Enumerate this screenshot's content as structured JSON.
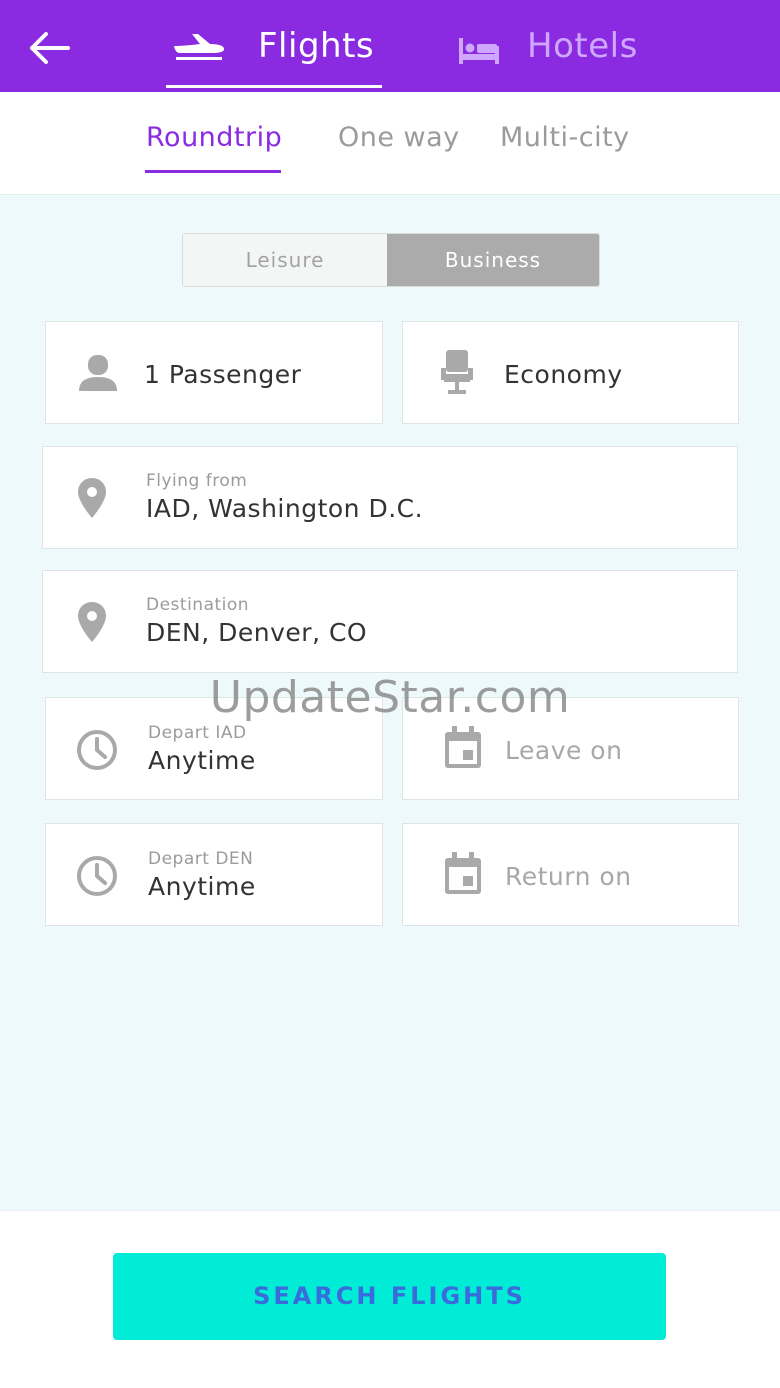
{
  "header": {
    "tabs": [
      {
        "label": "Flights",
        "icon": "plane-icon",
        "active": true
      },
      {
        "label": "Hotels",
        "icon": "bed-icon",
        "active": false
      }
    ],
    "back_icon": "back-arrow-icon",
    "color": "#8a2be2"
  },
  "trip_types": [
    {
      "label": "Roundtrip",
      "active": true
    },
    {
      "label": "One way",
      "active": false
    },
    {
      "label": "Multi-city",
      "active": false
    }
  ],
  "purpose": {
    "options": [
      "Leisure",
      "Business"
    ],
    "selected": "Business"
  },
  "passengers": {
    "value": "1 Passenger",
    "icon": "person-icon"
  },
  "cabin": {
    "value": "Economy",
    "icon": "seat-icon"
  },
  "origin": {
    "label": "Flying from",
    "value": "IAD, Washington D.C.",
    "icon": "location-pin-icon"
  },
  "destination": {
    "label": "Destination",
    "value": "DEN, Denver, CO",
    "icon": "location-pin-icon"
  },
  "depart_origin": {
    "label": "Depart IAD",
    "value": "Anytime",
    "icon": "clock-icon"
  },
  "leave_on": {
    "placeholder": "Leave on",
    "icon": "calendar-icon"
  },
  "depart_destination": {
    "label": "Depart DEN",
    "value": "Anytime",
    "icon": "clock-icon"
  },
  "return_on": {
    "placeholder": "Return on",
    "icon": "calendar-icon"
  },
  "watermark": "UpdateStar.com",
  "search_button": {
    "label": "SEARCH FLIGHTS",
    "color": "#00ecd6"
  }
}
